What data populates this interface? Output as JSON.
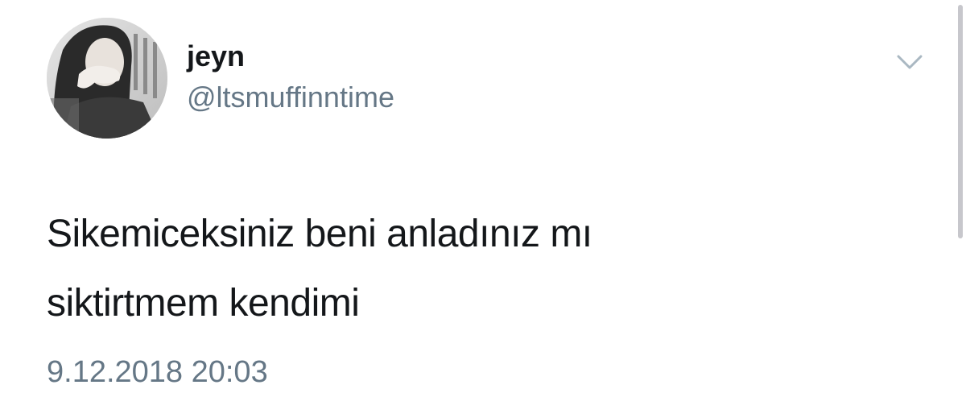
{
  "tweet": {
    "display_name": "jeyn",
    "handle": "@ltsmuffinntime",
    "text_lines": [
      "Sikemiceksiniz beni anladınız mı",
      "siktirtmem kendimi"
    ],
    "timestamp": "9.12.2018 20:03",
    "menu_icon": "chevron-down-icon"
  },
  "colors": {
    "name": "#14171a",
    "secondary": "#657786",
    "chevron": "#aab8c2"
  }
}
